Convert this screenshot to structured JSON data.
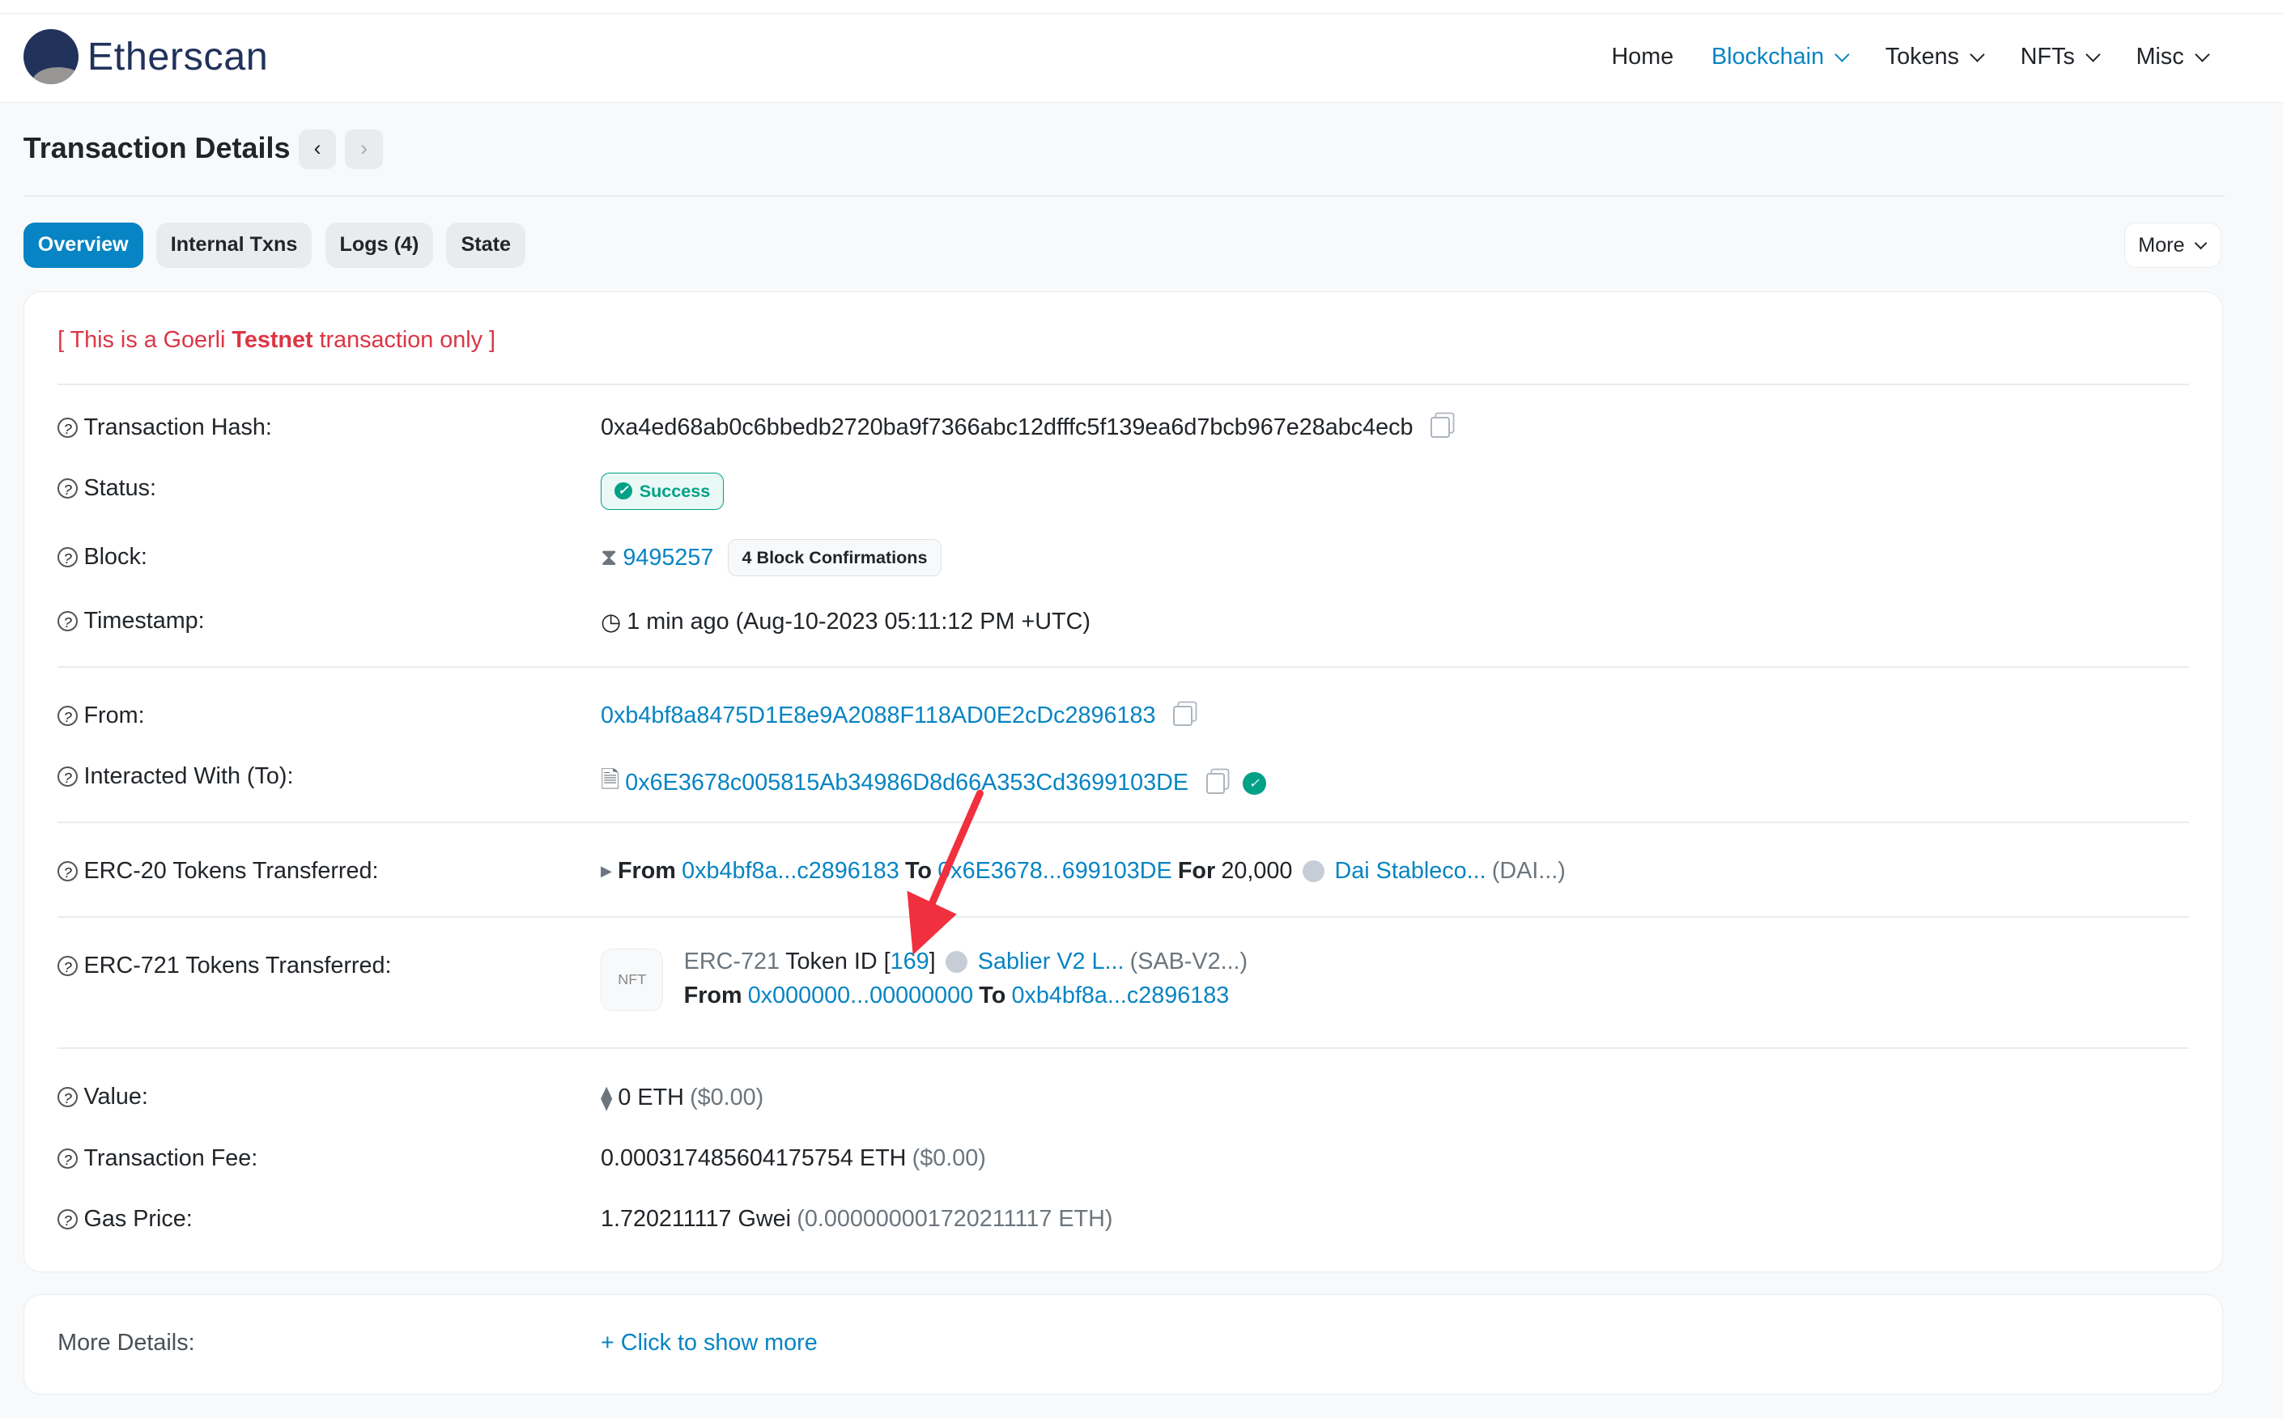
{
  "brand": {
    "name": "Etherscan"
  },
  "nav": [
    {
      "label": "Home"
    },
    {
      "label": "Blockchain"
    },
    {
      "label": "Tokens"
    },
    {
      "label": "NFTs"
    },
    {
      "label": "Misc"
    }
  ],
  "page": {
    "title": "Transaction Details",
    "prev": "‹",
    "next": "›"
  },
  "tabs": [
    {
      "label": "Overview"
    },
    {
      "label": "Internal Txns"
    },
    {
      "label": "Logs (4)"
    },
    {
      "label": "State"
    }
  ],
  "more_button": "More",
  "notice": {
    "prefix": "[ This is a Goerli ",
    "bold": "Testnet",
    "suffix": " transaction only ]"
  },
  "fields": {
    "hash": {
      "label": "Transaction Hash:",
      "value": "0xa4ed68ab0c6bbedb2720ba9f7366abc12dfffc5f139ea6d7bcb967e28abc4ecb"
    },
    "status": {
      "label": "Status:",
      "value": "Success"
    },
    "block": {
      "label": "Block:",
      "value": "9495257",
      "confirmations": "4 Block Confirmations"
    },
    "timestamp": {
      "label": "Timestamp:",
      "value": "1 min ago (Aug-10-2023 05:11:12 PM +UTC)"
    },
    "from": {
      "label": "From:",
      "value": "0xb4bf8a8475D1E8e9A2088F118AD0E2cDc2896183"
    },
    "to": {
      "label": "Interacted With (To):",
      "value": "0x6E3678c005815Ab34986D8d66A353Cd3699103DE"
    },
    "erc20": {
      "label": "ERC-20 Tokens Transferred:",
      "from_word": "From",
      "from": "0xb4bf8a...c2896183",
      "to_word": "To",
      "to": "0x6E3678...699103DE",
      "for_word": "For",
      "amount": "20,000",
      "token": "Dai Stableco...",
      "symbol": "(DAI...)"
    },
    "erc721": {
      "label": "ERC-721 Tokens Transferred:",
      "nft_icon": "NFT",
      "type": "ERC-721",
      "token_id_word": "Token ID [",
      "token_id": "169",
      "close": "]",
      "token": "Sablier V2 L...",
      "symbol": "(SAB-V2...)",
      "from_word": "From",
      "from": "0x000000...00000000",
      "to_word": "To",
      "to": "0xb4bf8a...c2896183"
    },
    "value": {
      "label": "Value:",
      "value": "0 ETH",
      "usd": "($0.00)"
    },
    "fee": {
      "label": "Transaction Fee:",
      "value": "0.000317485604175754 ETH",
      "usd": "($0.00)"
    },
    "gas": {
      "label": "Gas Price:",
      "value": "1.720211117 Gwei",
      "eth": "(0.000000001720211117 ETH)"
    }
  },
  "more_details": {
    "label": "More Details:",
    "link": "+ Click to show more"
  },
  "colors": {
    "accent": "#0784c3",
    "success": "#00a186",
    "notice": "#dc3545",
    "arrow": "#f0303f"
  }
}
